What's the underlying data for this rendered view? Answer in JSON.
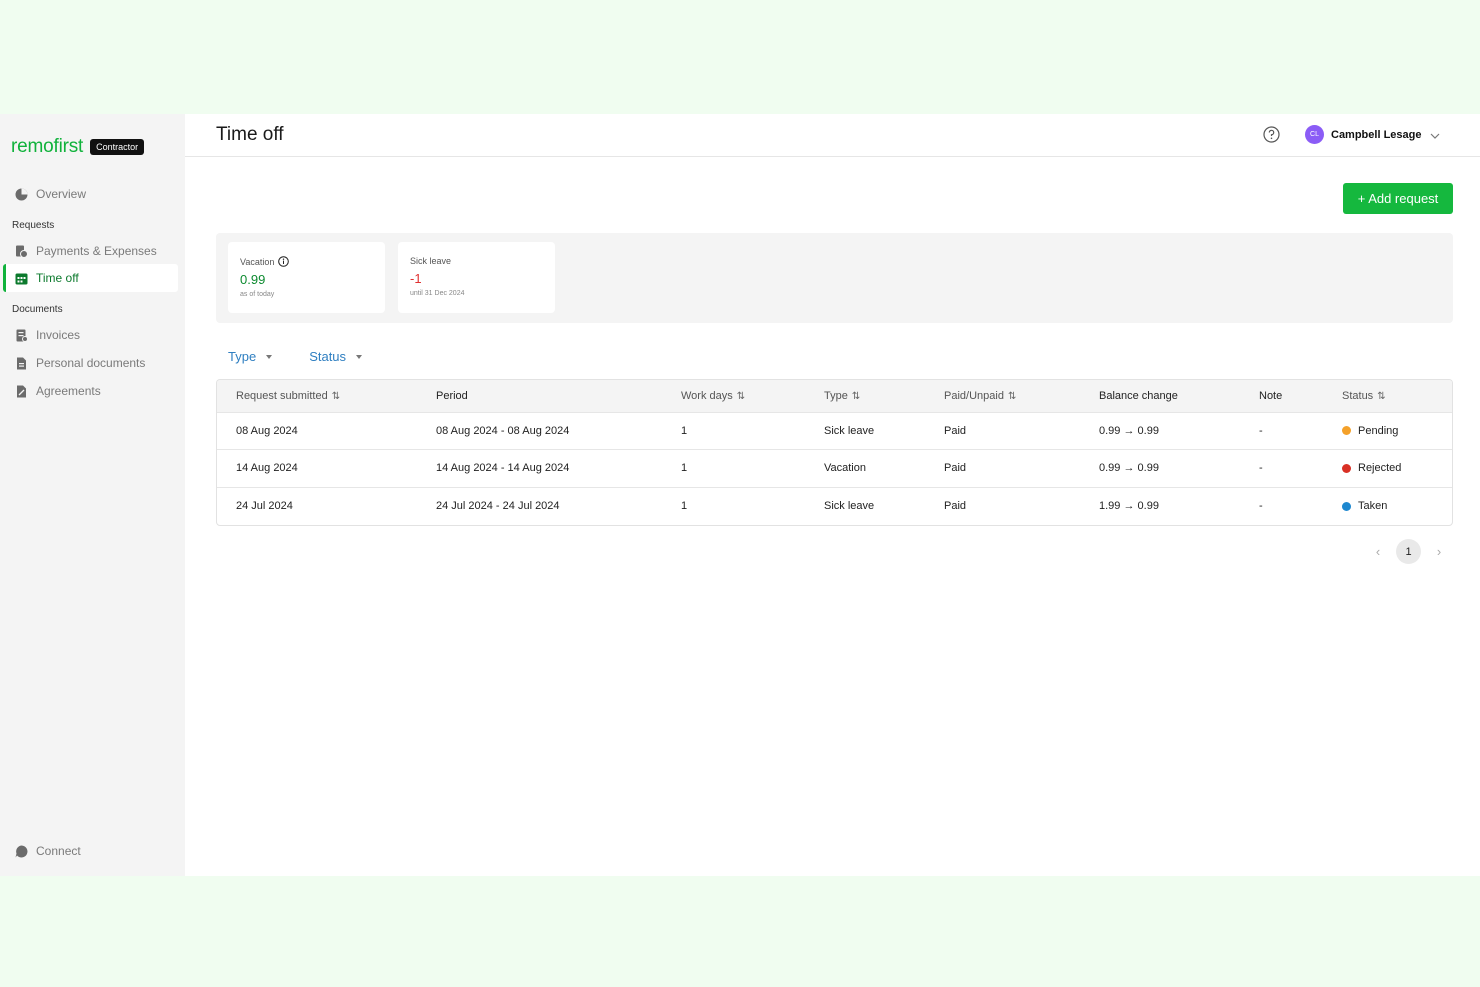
{
  "brand": {
    "logo": "remofirst",
    "badge": "Contractor"
  },
  "sidebar": {
    "overview": "Overview",
    "requests_section": "Requests",
    "payments": "Payments & Expenses",
    "time_off": "Time off",
    "documents_section": "Documents",
    "invoices": "Invoices",
    "personal_documents": "Personal documents",
    "agreements": "Agreements",
    "connect": "Connect"
  },
  "header": {
    "title": "Time off",
    "user": {
      "initials": "CL",
      "name": "Campbell Lesage"
    }
  },
  "add_request_label": "+ Add request",
  "balances": [
    {
      "label": "Vacation",
      "value": "0.99",
      "note": "as of today",
      "color": "#0c8a2f"
    },
    {
      "label": "Sick leave",
      "value": "-1",
      "note": "until 31 Dec 2024",
      "color": "#e03131"
    }
  ],
  "filters": {
    "type": "Type",
    "status": "Status"
  },
  "table": {
    "columns": [
      "Request submitted",
      "Period",
      "Work days",
      "Type",
      "Paid/Unpaid",
      "Balance change",
      "Note",
      "Status"
    ],
    "sort_glyph": "⇅",
    "rows": [
      {
        "submitted": "08 Aug 2024",
        "period": "08 Aug 2024 - 08 Aug 2024",
        "work_days": "1",
        "type": "Sick leave",
        "paid": "Paid",
        "balance": "0.99 → 0.99",
        "note": "-",
        "status": "Pending",
        "status_color": "#f4a12a"
      },
      {
        "submitted": "14 Aug 2024",
        "period": "14 Aug 2024 - 14 Aug 2024",
        "work_days": "1",
        "type": "Vacation",
        "paid": "Paid",
        "balance": "0.99 → 0.99",
        "note": "-",
        "status": "Rejected",
        "status_color": "#d93025"
      },
      {
        "submitted": "24 Jul 2024",
        "period": "24 Jul 2024 - 24 Jul 2024",
        "work_days": "1",
        "type": "Sick leave",
        "paid": "Paid",
        "balance": "1.99 → 0.99",
        "note": "-",
        "status": "Taken",
        "status_color": "#1e88d0"
      }
    ]
  },
  "pagination": {
    "current": "1",
    "prev": "‹",
    "next": "›"
  },
  "colors": {
    "brand_green": "#10b23b",
    "link_blue": "#2f7fc1",
    "avatar": "#8b5cf6"
  }
}
